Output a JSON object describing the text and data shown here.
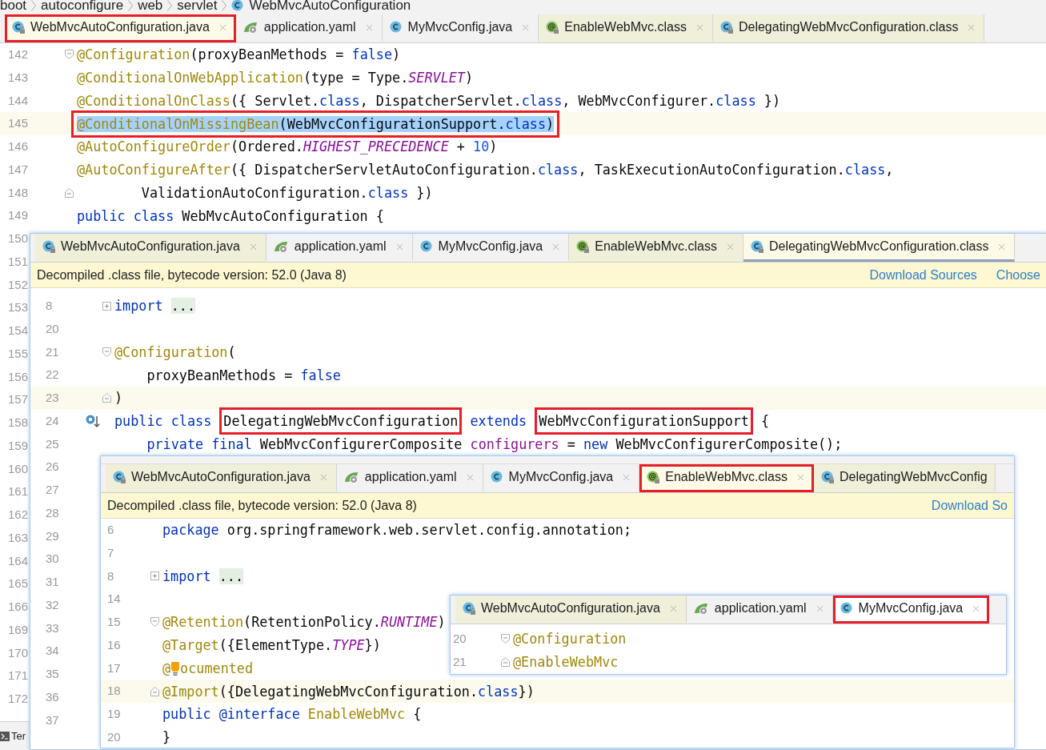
{
  "panels": [
    {
      "breadcrumb": [
        {
          "text": "boot",
          "kind": "package"
        },
        {
          "text": "autoconfigure",
          "kind": "package"
        },
        {
          "text": "web",
          "kind": "package"
        },
        {
          "text": "servlet",
          "kind": "package"
        },
        {
          "text": "WebMvcAutoConfiguration",
          "kind": "class"
        }
      ],
      "tabs": [
        {
          "label": "WebMvcAutoConfiguration.java",
          "kind": "class",
          "library": true,
          "selected": true,
          "boxed": true,
          "closable": true
        },
        {
          "label": "application.yaml",
          "kind": "yaml",
          "library": false,
          "selected": false,
          "boxed": false,
          "closable": true
        },
        {
          "label": "MyMvcConfig.java",
          "kind": "class",
          "library": false,
          "selected": false,
          "boxed": false,
          "closable": true
        },
        {
          "label": "EnableWebMvc.class",
          "kind": "annotation",
          "library": true,
          "selected": false,
          "boxed": false,
          "closable": true
        },
        {
          "label": "DelegatingWebMvcConfiguration.class",
          "kind": "class",
          "library": true,
          "selected": false,
          "boxed": false,
          "closable": true
        }
      ],
      "lines": [
        {
          "number": "142",
          "kind": "opener",
          "current": false,
          "code": [
            {
              "text": "@Configuration",
              "kind": "annotation"
            },
            {
              "text": "(proxyBeanMethods = ",
              "kind": "plain"
            },
            {
              "text": "false",
              "kind": "keyword"
            },
            {
              "text": ")",
              "kind": "plain"
            }
          ]
        },
        {
          "number": "143",
          "kind": "code",
          "current": false,
          "code": [
            {
              "text": "@ConditionalOnWebApplication",
              "kind": "annotation"
            },
            {
              "text": "(type = Type.",
              "kind": "plain"
            },
            {
              "text": "SERVLET",
              "kind": "constant"
            },
            {
              "text": ")",
              "kind": "plain"
            }
          ]
        },
        {
          "number": "144",
          "kind": "code",
          "current": false,
          "code": [
            {
              "text": "@ConditionalOnClass",
              "kind": "annotation"
            },
            {
              "text": "({ Servlet.",
              "kind": "plain"
            },
            {
              "text": "class",
              "kind": "keyword"
            },
            {
              "text": ", DispatcherServlet.",
              "kind": "plain"
            },
            {
              "text": "class",
              "kind": "keyword"
            },
            {
              "text": ", WebMvcConfigurer.",
              "kind": "plain"
            },
            {
              "text": "class",
              "kind": "keyword"
            },
            {
              "text": " })",
              "kind": "plain"
            }
          ]
        },
        {
          "number": "145",
          "kind": "code",
          "current": true,
          "selected": true,
          "boxed": true,
          "code": [
            {
              "text": "@ConditionalOnMissingBean",
              "kind": "annotation"
            },
            {
              "text": "(WebMvcConfigurationSupport.",
              "kind": "plain"
            },
            {
              "text": "class",
              "kind": "keyword"
            },
            {
              "text": ")",
              "kind": "plain"
            }
          ]
        },
        {
          "number": "146",
          "kind": "code",
          "current": false,
          "code": [
            {
              "text": "@AutoConfigureOrder",
              "kind": "annotation"
            },
            {
              "text": "(Ordered.",
              "kind": "plain"
            },
            {
              "text": "HIGHEST_PRECEDENCE",
              "kind": "constant"
            },
            {
              "text": " + ",
              "kind": "plain"
            },
            {
              "text": "10",
              "kind": "number"
            },
            {
              "text": ")",
              "kind": "plain"
            }
          ]
        },
        {
          "number": "147",
          "kind": "code",
          "current": false,
          "code": [
            {
              "text": "@AutoConfigureAfter",
              "kind": "annotation"
            },
            {
              "text": "({ DispatcherServletAutoConfiguration.",
              "kind": "plain"
            },
            {
              "text": "class",
              "kind": "keyword"
            },
            {
              "text": ", TaskExecutionAutoConfiguration.",
              "kind": "plain"
            },
            {
              "text": "class",
              "kind": "keyword"
            },
            {
              "text": ",",
              "kind": "plain"
            }
          ]
        },
        {
          "number": "148",
          "kind": "closer",
          "current": false,
          "code": [
            {
              "text": "        ValidationAutoConfiguration.",
              "kind": "plain"
            },
            {
              "text": "class",
              "kind": "keyword"
            },
            {
              "text": " })",
              "kind": "plain"
            }
          ]
        },
        {
          "number": "149",
          "kind": "code",
          "current": false,
          "code": [
            {
              "text": "public class ",
              "kind": "keyword"
            },
            {
              "text": "WebMvcAutoConfiguration {",
              "kind": "plain"
            }
          ]
        },
        {
          "number": "150",
          "kind": "code",
          "current": false
        },
        {
          "number": "151",
          "kind": "code",
          "current": false
        },
        {
          "number": "152",
          "kind": "code",
          "current": false
        },
        {
          "number": "153",
          "kind": "code",
          "current": false
        },
        {
          "number": "154",
          "kind": "code",
          "current": false
        },
        {
          "number": "155",
          "kind": "code",
          "current": false
        },
        {
          "number": "156",
          "kind": "code",
          "current": false
        },
        {
          "number": "157",
          "kind": "code",
          "current": false
        },
        {
          "number": "158",
          "kind": "code",
          "current": false
        },
        {
          "number": "159",
          "kind": "code",
          "current": false
        },
        {
          "number": "160",
          "kind": "code",
          "current": false
        },
        {
          "number": "161",
          "kind": "code",
          "current": false
        },
        {
          "number": "162",
          "kind": "code",
          "current": false
        },
        {
          "number": "163",
          "kind": "code",
          "current": false
        },
        {
          "number": "164",
          "kind": "code",
          "current": false
        },
        {
          "number": "165",
          "kind": "code",
          "current": false
        },
        {
          "number": "166",
          "kind": "code",
          "current": false
        },
        {
          "number": "169",
          "kind": "code",
          "current": false
        },
        {
          "number": "170",
          "kind": "code",
          "current": false
        },
        {
          "number": "171",
          "kind": "code",
          "current": false
        },
        {
          "number": "172",
          "kind": "code",
          "current": false
        }
      ],
      "terminal_tab": "Ter"
    },
    {
      "tabs": [
        {
          "label": "WebMvcAutoConfiguration.java",
          "kind": "class",
          "library": true,
          "selected": false,
          "boxed": false,
          "closable": true
        },
        {
          "label": "application.yaml",
          "kind": "yaml",
          "library": false,
          "selected": false,
          "boxed": false,
          "closable": true
        },
        {
          "label": "MyMvcConfig.java",
          "kind": "class",
          "library": false,
          "selected": false,
          "boxed": false,
          "closable": true
        },
        {
          "label": "EnableWebMvc.class",
          "kind": "annotation",
          "library": true,
          "selected": false,
          "boxed": false,
          "closable": true
        },
        {
          "label": "DelegatingWebMvcConfiguration.class",
          "kind": "class",
          "library": true,
          "selected": true,
          "boxed": false,
          "closable": true
        }
      ],
      "banner": {
        "text": "Decompiled .class file, bytecode version: 52.0 (Java 8)",
        "links": [
          "Download Sources",
          "Choose"
        ]
      },
      "lines": [
        {
          "number": "8",
          "kind": "collapsed",
          "current": false,
          "code": [
            {
              "text": "import ",
              "kind": "keyword"
            },
            {
              "text": "...",
              "kind": "folded"
            }
          ]
        },
        {
          "number": "20",
          "kind": "code",
          "current": false
        },
        {
          "number": "21",
          "kind": "opener",
          "current": false,
          "code": [
            {
              "text": "@Configuration",
              "kind": "annotation"
            },
            {
              "text": "(",
              "kind": "plain"
            }
          ]
        },
        {
          "number": "22",
          "kind": "code",
          "current": false,
          "code": [
            {
              "text": "    proxyBeanMethods = ",
              "kind": "plain"
            },
            {
              "text": "false",
              "kind": "keyword"
            }
          ]
        },
        {
          "number": "23",
          "kind": "closer",
          "current": true,
          "code": [
            {
              "text": ")",
              "kind": "plain"
            }
          ]
        },
        {
          "number": "24",
          "kind": "override",
          "current": false,
          "code": [
            {
              "text": "public class ",
              "kind": "keyword"
            },
            {
              "text": "DelegatingWebMvcConfiguration",
              "kind": "plain",
              "boxed": true
            },
            {
              "text": " extends ",
              "kind": "keyword"
            },
            {
              "text": "WebMvcConfigurationSupport",
              "kind": "plain",
              "boxed": true
            },
            {
              "text": " {",
              "kind": "plain"
            }
          ]
        },
        {
          "number": "25",
          "kind": "code",
          "current": false,
          "code": [
            {
              "text": "    private final ",
              "kind": "keyword"
            },
            {
              "text": "WebMvcConfigurerComposite ",
              "kind": "plain"
            },
            {
              "text": "configurers",
              "kind": "field"
            },
            {
              "text": " = ",
              "kind": "plain"
            },
            {
              "text": "new ",
              "kind": "keyword"
            },
            {
              "text": "WebMvcConfigurerComposite();",
              "kind": "plain"
            }
          ]
        },
        {
          "number": "26",
          "kind": "code",
          "current": false
        },
        {
          "number": "27",
          "kind": "code",
          "current": false
        },
        {
          "number": "28",
          "kind": "code",
          "current": false
        },
        {
          "number": "29",
          "kind": "code",
          "current": false
        },
        {
          "number": "30",
          "kind": "code",
          "current": false
        },
        {
          "number": "31",
          "kind": "code",
          "current": false
        },
        {
          "number": "32",
          "kind": "code",
          "current": false
        },
        {
          "number": "33",
          "kind": "code",
          "current": false
        },
        {
          "number": "34",
          "kind": "code",
          "current": false
        },
        {
          "number": "35",
          "kind": "code",
          "current": false
        },
        {
          "number": "36",
          "kind": "code",
          "current": false
        },
        {
          "number": "37",
          "kind": "code",
          "current": false
        }
      ]
    },
    {
      "tabs": [
        {
          "label": "WebMvcAutoConfiguration.java",
          "kind": "class",
          "library": true,
          "selected": false,
          "boxed": false,
          "closable": true
        },
        {
          "label": "application.yaml",
          "kind": "yaml",
          "library": false,
          "selected": false,
          "boxed": false,
          "closable": true
        },
        {
          "label": "MyMvcConfig.java",
          "kind": "class",
          "library": false,
          "selected": false,
          "boxed": false,
          "closable": true
        },
        {
          "label": "EnableWebMvc.class",
          "kind": "annotation",
          "library": true,
          "selected": true,
          "boxed": true,
          "closable": true
        },
        {
          "label": "DelegatingWebMvcConfig",
          "kind": "class",
          "library": true,
          "selected": false,
          "boxed": false,
          "closable": false
        }
      ],
      "banner": {
        "text": "Decompiled .class file, bytecode version: 52.0 (Java 8)",
        "links": [
          "Download So"
        ]
      },
      "lines": [
        {
          "number": "6",
          "kind": "code",
          "current": false,
          "code": [
            {
              "text": "package ",
              "kind": "keyword"
            },
            {
              "text": "org.springframework.web.servlet.config.annotation;",
              "kind": "plain"
            }
          ]
        },
        {
          "number": "7",
          "kind": "code",
          "current": false
        },
        {
          "number": "8",
          "kind": "collapsed",
          "current": false,
          "code": [
            {
              "text": "import ",
              "kind": "keyword"
            },
            {
              "text": "...",
              "kind": "folded"
            }
          ]
        },
        {
          "number": "14",
          "kind": "code",
          "current": false
        },
        {
          "number": "15",
          "kind": "opener",
          "current": false,
          "code": [
            {
              "text": "@Retention",
              "kind": "annotation"
            },
            {
              "text": "(RetentionPolicy.",
              "kind": "plain"
            },
            {
              "text": "RUNTIME",
              "kind": "constant"
            },
            {
              "text": ")",
              "kind": "plain"
            }
          ]
        },
        {
          "number": "16",
          "kind": "code",
          "current": false,
          "code": [
            {
              "text": "@Target",
              "kind": "annotation"
            },
            {
              "text": "({ElementType.",
              "kind": "plain"
            },
            {
              "text": "TYPE",
              "kind": "constant"
            },
            {
              "text": "})",
              "kind": "plain"
            }
          ]
        },
        {
          "number": "17",
          "kind": "code",
          "current": false,
          "code": [
            {
              "text": "@",
              "kind": "annotation"
            },
            {
              "kind": "bulb"
            },
            {
              "text": "ocumented",
              "kind": "annotation"
            }
          ]
        },
        {
          "number": "18",
          "kind": "closer",
          "current": true,
          "code": [
            {
              "text": "@Import",
              "kind": "annotation"
            },
            {
              "text": "({DelegatingWebMvcConfiguration.",
              "kind": "plain"
            },
            {
              "text": "class",
              "kind": "keyword"
            },
            {
              "text": "})",
              "kind": "plain"
            }
          ]
        },
        {
          "number": "19",
          "kind": "code",
          "current": false,
          "code": [
            {
              "text": "public @interface ",
              "kind": "keyword"
            },
            {
              "text": "EnableWebMvc",
              "kind": "annotation"
            },
            {
              "text": " {",
              "kind": "plain"
            }
          ]
        },
        {
          "number": "20",
          "kind": "code",
          "current": false,
          "code": [
            {
              "text": "}",
              "kind": "plain"
            }
          ]
        }
      ]
    },
    {
      "tabs": [
        {
          "label": "WebMvcAutoConfiguration.java",
          "kind": "class",
          "library": true,
          "selected": false,
          "boxed": false,
          "closable": true
        },
        {
          "label": "application.yaml",
          "kind": "yaml",
          "library": false,
          "selected": false,
          "boxed": false,
          "closable": true
        },
        {
          "label": "MyMvcConfig.java",
          "kind": "class",
          "library": false,
          "selected": true,
          "boxed": true,
          "closable": true
        }
      ],
      "lines": [
        {
          "number": "20",
          "kind": "opener",
          "current": false,
          "code": [
            {
              "text": "@Configuration",
              "kind": "annotation"
            }
          ]
        },
        {
          "number": "21",
          "kind": "closer",
          "current": false,
          "code": [
            {
              "text": "@EnableWebMvc",
              "kind": "annotation"
            }
          ]
        }
      ]
    }
  ]
}
